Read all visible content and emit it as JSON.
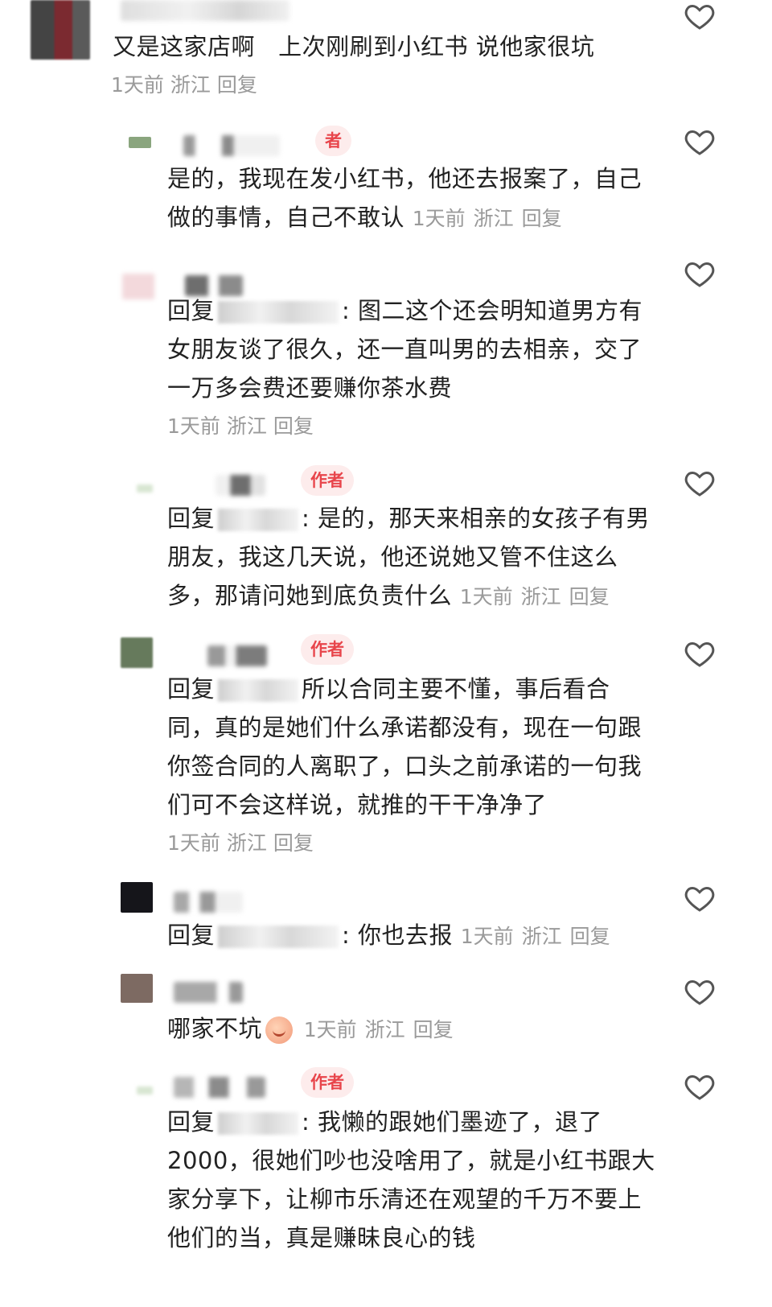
{
  "comments": [
    {
      "text": "又是这家店啊   上次刚刷到小红书 说他家很坑",
      "time": "1天前",
      "location": "浙江",
      "reply": "回复"
    },
    {
      "author_badge": "者",
      "text": "是的，我现在发小红书，他还去报案了，自己做的事情，自己不敢认",
      "time": "1天前",
      "location": "浙江",
      "reply": "回复"
    },
    {
      "prefix": "回复",
      "text": ": 图二这个还会明知道男方有女朋友谈了很久，还一直叫男的去相亲，交了一万多会费还要赚你茶水费",
      "time": "1天前",
      "location": "浙江",
      "reply": "回复"
    },
    {
      "author_badge": "作者",
      "prefix": "回复",
      "text": ": 是的，那天来相亲的女孩子有男朋友，我这几天说，他还说她又管不住这么多，那请问她到底负责什么",
      "time": "1天前",
      "location": "浙江",
      "reply": "回复"
    },
    {
      "author_badge": "作者",
      "prefix": "回复",
      "text": "所以合同主要不懂，事后看合同，真的是她们什么承诺都没有，现在一句跟你签合同的人离职了，口头之前承诺的一句我们可不会这样说，就推的干干净净了",
      "time": "1天前",
      "location": "浙江",
      "reply": "回复"
    },
    {
      "prefix": "回复",
      "text": ": 你也去报",
      "time": "1天前",
      "location": "浙江",
      "reply": "回复"
    },
    {
      "text": "哪家不坑",
      "emoji": "peach-face-emoji",
      "time": "1天前",
      "location": "浙江",
      "reply": "回复"
    },
    {
      "author_badge": "作者",
      "prefix": "回复",
      "text": ": 我懒的跟她们墨迹了，退了2000，很她们吵也没啥用了，就是小红书跟大家分享下，让柳市乐清还在观望的千万不要上他们的当，真是赚昧良心的钱"
    }
  ]
}
